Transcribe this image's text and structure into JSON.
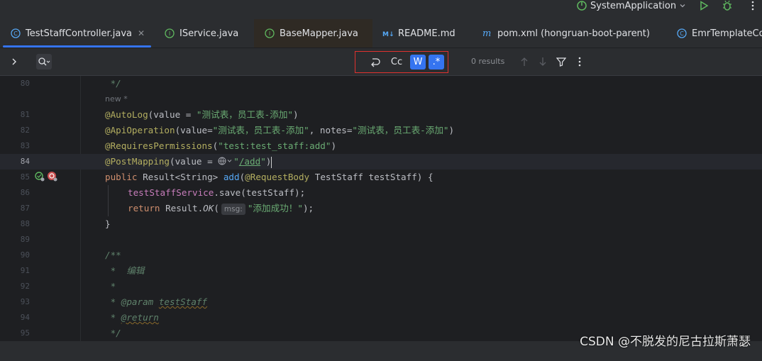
{
  "toolbar": {
    "run_config": "SystemApplication"
  },
  "tabs": [
    {
      "label": "TestStaffController.java",
      "icon": "class-icon",
      "active": true,
      "closable": true
    },
    {
      "label": "IService.java",
      "icon": "interface-icon"
    },
    {
      "label": "BaseMapper.java",
      "icon": "interface-icon"
    },
    {
      "label": "README.md",
      "icon": "markdown-icon"
    },
    {
      "label": "pom.xml (hongruan-boot-parent)",
      "icon": "maven-icon"
    },
    {
      "label": "EmrTemplateCon",
      "icon": "class-icon"
    }
  ],
  "find": {
    "match_case_label": "Cc",
    "words_label": "W",
    "regex_label": ".*",
    "results": "0 results"
  },
  "editor": {
    "line_numbers": [
      "80",
      "81",
      "82",
      "83",
      "84",
      "85",
      "86",
      "87",
      "88",
      "89",
      "90",
      "91",
      "92",
      "93",
      "94",
      "95"
    ],
    "new_hint": "new *",
    "current_line": "84",
    "code": {
      "l80": " */",
      "l81_ann": "@AutoLog",
      "l81_a": "(value = ",
      "l81_s": "\"测试表，员工表-添加\"",
      "l81_b": ")",
      "l82_ann": "@ApiOperation",
      "l82_a": "(value=",
      "l82_s1": "\"测试表，员工表-添加\"",
      "l82_b": ", notes=",
      "l82_s2": "\"测试表，员工表-添加\"",
      "l82_c": ")",
      "l83_ann": "@RequiresPermissions",
      "l83_a": "(",
      "l83_s": "\"test:test_staff:add\"",
      "l83_b": ")",
      "l84_ann": "@PostMapping",
      "l84_a": "(value = ",
      "l84_q1": "\"",
      "l84_url": "/add",
      "l84_q2": "\"",
      "l84_b": ")",
      "l85_kw": "public ",
      "l85_a": "Result<String> ",
      "l85_fn": "add",
      "l85_b": "(",
      "l85_ann": "@RequestBody",
      "l85_c": " TestStaff testStaff) {",
      "l86_field": "testStaffService",
      "l86_a": ".save(testStaff);",
      "l87_kw": "return ",
      "l87_a": "Result.",
      "l87_it": "OK",
      "l87_b": "(",
      "l87_hint": "msg:",
      "l87_s": "\"添加成功！\"",
      "l87_c": ");",
      "l88": "}",
      "l90": "/**",
      "l91": " *  编辑",
      "l92": " *",
      "l93_a": " * ",
      "l93_tag": "@param",
      "l93_sp": " ",
      "l93_p": "testStaff",
      "l94_a": " * ",
      "l94_tag": "@return",
      "l95": " */"
    }
  },
  "watermark": "CSDN @不脱发的尼古拉斯萧瑟",
  "colors": {
    "accent": "#3574f0",
    "highlight_box": "#e0312e",
    "annotation": "#b3ae60",
    "string": "#6aab73",
    "keyword": "#cf8e6d"
  }
}
